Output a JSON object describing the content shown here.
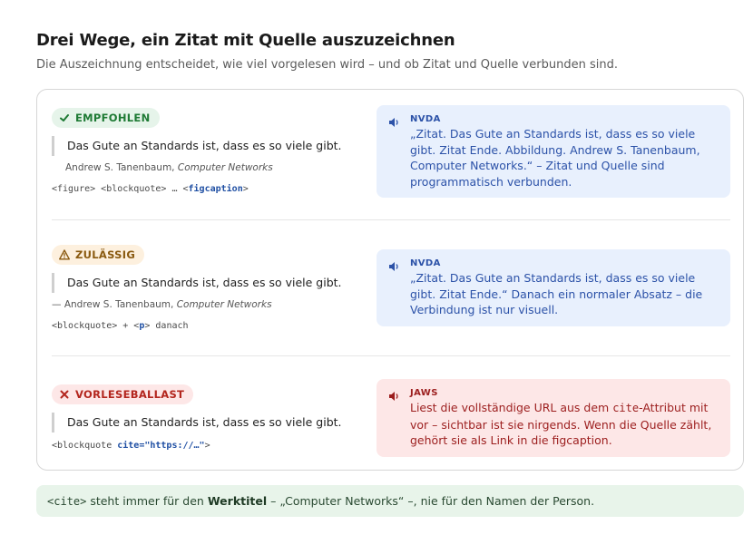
{
  "header": {
    "title": "Drei Wege, ein Zitat mit Quelle auszuzeichnen",
    "subtitle": "Die Auszeichnung entscheidet, wie viel vorgelesen wird – und ob Zitat und Quelle verbunden sind."
  },
  "rows": [
    {
      "badge": "EMPFOHLEN",
      "badge_icon": "check-icon",
      "quote": "Das Gute an Standards ist, dass es so viele gibt.",
      "caption_author": "Andrew S. Tanenbaum,",
      "caption_work": "Computer Networks",
      "code_parts": [
        "<figure> <blockquote> … <",
        "figcaption",
        ">"
      ],
      "reader": "NVDA",
      "reader_text": "„Zitat. Das Gute an Standards ist, dass es so viele gibt. Zitat Ende. Abbildung. Andrew S. Tanenbaum, Computer Networks.“ – Zitat und Quelle sind programmatisch verbunden."
    },
    {
      "badge": "ZULÄSSIG",
      "badge_icon": "warning-icon",
      "quote": "Das Gute an Standards ist, dass es so viele gibt.",
      "caption_author": "— Andrew S. Tanenbaum,",
      "caption_work": "Computer Networks",
      "code_parts": [
        "<blockquote> + <",
        "p",
        "> danach"
      ],
      "reader": "NVDA",
      "reader_text": "„Zitat. Das Gute an Standards ist, dass es so viele gibt. Zitat Ende.“ Danach ein normaler Absatz – die Verbindung ist nur visuell."
    },
    {
      "badge": "VORLESEBALLAST",
      "badge_icon": "x-icon",
      "quote": "Das Gute an Standards ist, dass es so viele gibt.",
      "code_parts": [
        "<blockquote ",
        "cite=\"https://…\"",
        ">"
      ],
      "reader": "JAWS",
      "reader_text_before": "Liest die vollständige URL aus dem ",
      "reader_text_code": "cite",
      "reader_text_after": "-Attribut mit vor – sichtbar ist sie nirgends. Wenn die Quelle zählt, gehört sie als Link in die figcaption."
    }
  ],
  "note": {
    "code": "<cite>",
    "before": " steht immer für den ",
    "bold": "Werktitel",
    "after": " – „Computer Networks“ –, nie für den Namen der Person."
  },
  "colors": {
    "accent_green": "#1e7a34",
    "accent_amber": "#8a5a10",
    "accent_red": "#b3261e",
    "reader_blue": "#2c52a8"
  }
}
